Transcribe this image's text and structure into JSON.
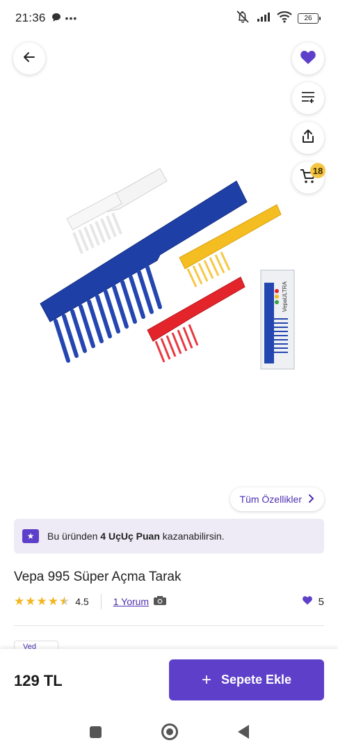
{
  "status_bar": {
    "time": "21:36",
    "battery": "26"
  },
  "actions": {
    "cart_count": "18"
  },
  "features_button": {
    "label": "Tüm Özellikler"
  },
  "points_banner": {
    "prefix": "Bu üründen",
    "points": "4 UçUç Puan",
    "suffix": "kazanabilirsin."
  },
  "product": {
    "title": "Vepa 995 Süper Açma Tarak",
    "rating": "4.5",
    "review_link": "1 Yorum",
    "likes": "5",
    "package_label": "VepaULTRA"
  },
  "next_section_peek": {
    "label": "Ved"
  },
  "bottom_bar": {
    "price": "129 TL",
    "add_to_cart": "Sepete Ekle"
  },
  "colors": {
    "accent": "#5e3fc9",
    "star": "#f3b51b",
    "badge": "#f6c543"
  }
}
